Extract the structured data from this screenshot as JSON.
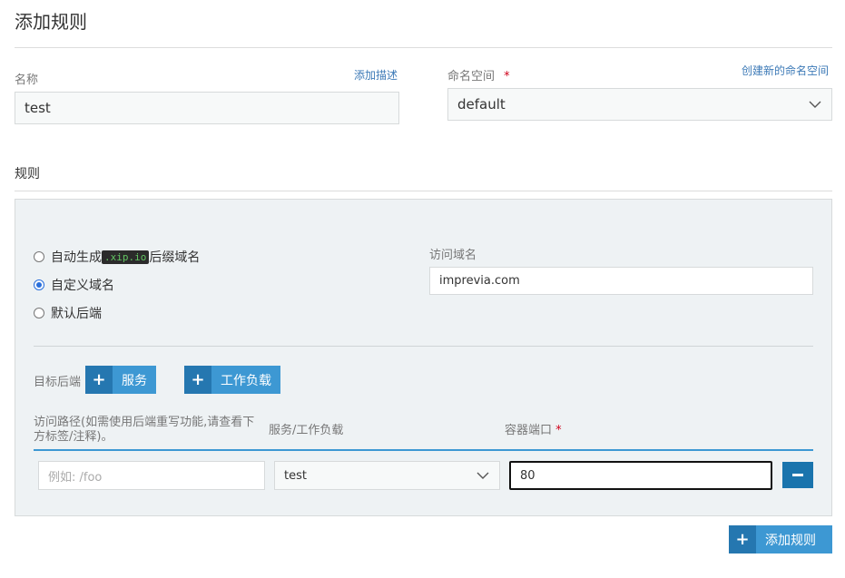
{
  "page": {
    "title": "添加规则"
  },
  "name_field": {
    "label": "名称",
    "value": "test",
    "add_desc_link": "添加描述"
  },
  "namespace_field": {
    "label": "命名空间",
    "required_mark": "*",
    "value": "default",
    "create_link": "创建新的命名空间"
  },
  "rules": {
    "section_title": "规则",
    "domain_options": [
      {
        "label_before": "自动生成",
        "code": ".xip.io",
        "label_after": "后缀域名",
        "checked": false
      },
      {
        "label": "自定义域名",
        "checked": true
      },
      {
        "label": "默认后端",
        "checked": false
      }
    ],
    "access_domain": {
      "label": "访问域名",
      "value": "imprevia.com"
    },
    "target_backend": {
      "label": "目标后端",
      "service_button": "服务",
      "workload_button": "工作负载"
    },
    "table": {
      "col_path": "访问路径(如需使用后端重写功能,请查看下方标签/注释)。",
      "col_service": "服务/工作负载",
      "col_port": "容器端口",
      "col_port_required": "*",
      "row": {
        "path_placeholder": "例如: /foo",
        "service_value": "test",
        "port_value": "80"
      }
    },
    "add_rule_button": "添加规则"
  },
  "colors": {
    "primary": "#3d98d3",
    "primary_dark": "#2577b0",
    "link": "#3d7ab7",
    "required": "#d0021b"
  }
}
